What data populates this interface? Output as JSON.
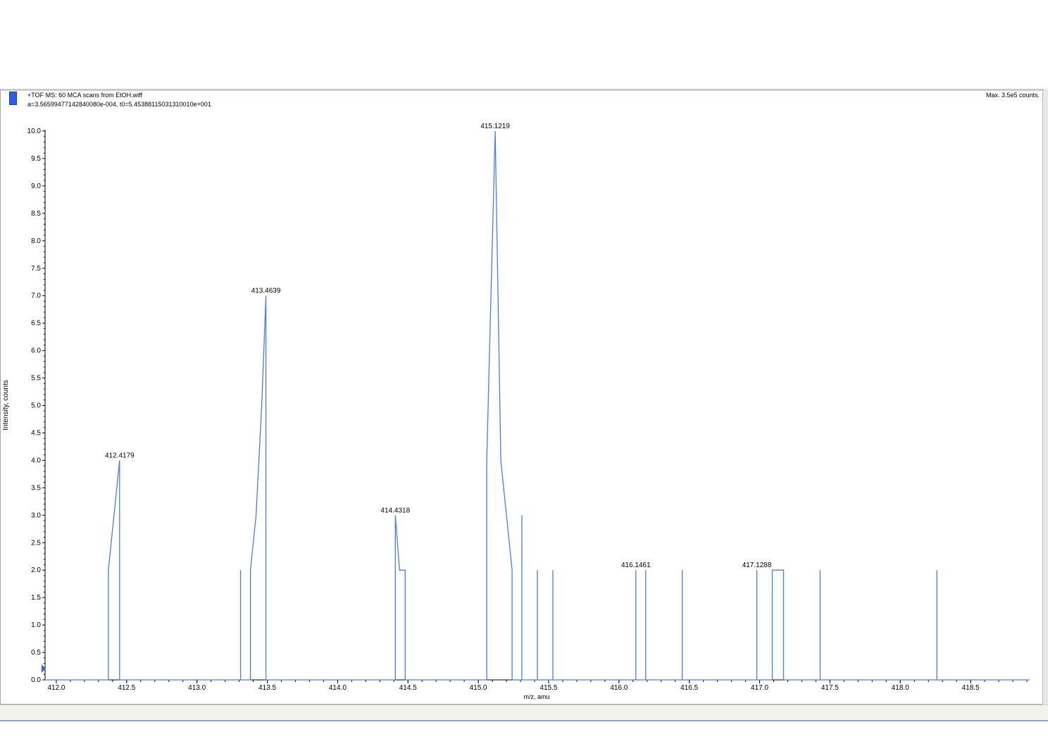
{
  "header": {
    "title": "+TOF MS: 60 MCA scans from EtOH.wiff",
    "calibration": "a=3.56599477142840080e-004, t0=5.45388115031310010e+001",
    "max_label": "Max. 3.5e5 counts."
  },
  "colors": {
    "trace": "#4a7af4",
    "marker": "#2c5cf0",
    "axis": "#000000"
  },
  "chart_data": {
    "type": "line",
    "xlabel": "m/z, amu",
    "ylabel": "Intensity, counts",
    "xlim": [
      411.92,
      418.92
    ],
    "ylim": [
      0,
      10
    ],
    "xticks": [
      412.0,
      412.5,
      413.0,
      413.5,
      414.0,
      414.5,
      415.0,
      415.5,
      416.0,
      416.5,
      417.0,
      417.5,
      418.0,
      418.5
    ],
    "xtick_labels": [
      "412.0",
      "412.5",
      "413.0",
      "413.5",
      "414.0",
      "414.5",
      "415.0",
      "415.5",
      "416.0",
      "416.5",
      "417.0",
      "417.5",
      "418.0",
      "418.5"
    ],
    "yticks": [
      0,
      0.5,
      1,
      1.5,
      2,
      2.5,
      3,
      3.5,
      4,
      4.5,
      5,
      5.5,
      6,
      6.5,
      7,
      7.5,
      8,
      8.5,
      9,
      9.5,
      10
    ],
    "ytick_labels": [
      "0.0",
      "0.5",
      "1.0",
      "1.5",
      "2.0",
      "2.5",
      "3.0",
      "3.5",
      "4.0",
      "4.5",
      "5.0",
      "5.5",
      "6.0",
      "6.5",
      "7.0",
      "7.5",
      "8.0",
      "8.5",
      "9.0",
      "9.5",
      "10.0"
    ],
    "series": [
      {
        "x": [
          411.92,
          412.37,
          412.37,
          412.45,
          412.45,
          413.31,
          413.31,
          413.31,
          413.38,
          413.38,
          413.42,
          413.46,
          413.49,
          413.49,
          414.41,
          414.41,
          414.44,
          414.48,
          414.48,
          415.06,
          415.06,
          415.09,
          415.12,
          415.16,
          415.24,
          415.24,
          415.31,
          415.31,
          415.31,
          415.42,
          415.42,
          415.42,
          415.53,
          415.53,
          415.53,
          416.12,
          416.12,
          416.12,
          416.19,
          416.19,
          416.19,
          416.45,
          416.45,
          416.45,
          416.98,
          416.98,
          416.98,
          417.09,
          417.09,
          417.17,
          417.17,
          417.43,
          417.43,
          417.43,
          418.26,
          418.26,
          418.26,
          418.92
        ],
        "y": [
          0,
          0,
          2,
          4,
          0,
          0,
          2,
          0,
          0,
          2,
          3,
          5,
          7,
          0,
          0,
          3,
          2,
          2,
          0,
          0,
          4,
          7,
          10,
          4,
          2,
          0,
          0,
          3,
          0,
          0,
          2,
          0,
          0,
          2,
          0,
          0,
          2,
          0,
          0,
          2,
          0,
          0,
          2,
          0,
          0,
          2,
          0,
          0,
          2,
          2,
          0,
          0,
          2,
          0,
          0,
          2,
          0,
          0
        ]
      }
    ],
    "peak_labels": [
      {
        "text": "412.4179",
        "x": 412.45,
        "y": 4
      },
      {
        "text": "413.4639",
        "x": 413.49,
        "y": 7
      },
      {
        "text": "414.4318",
        "x": 414.41,
        "y": 3
      },
      {
        "text": "415.1219",
        "x": 415.12,
        "y": 10
      },
      {
        "text": "416.1461",
        "x": 416.12,
        "y": 2
      },
      {
        "text": "417.1288",
        "x": 416.98,
        "y": 2
      }
    ]
  }
}
